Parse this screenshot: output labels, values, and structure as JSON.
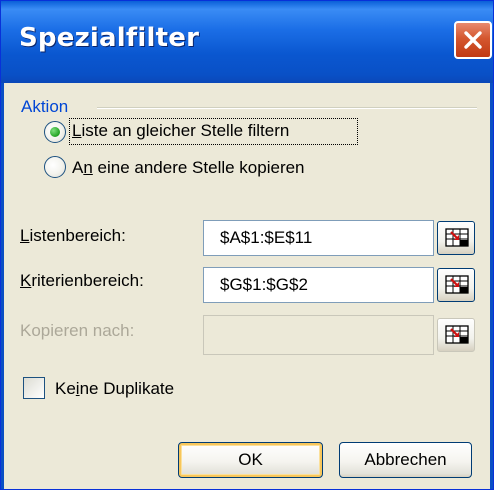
{
  "window": {
    "title": "Spezialfilter",
    "close_icon": "close-icon"
  },
  "group": {
    "label": "Aktion"
  },
  "radios": [
    {
      "pre": "",
      "u": "L",
      "post": "iste an gleicher Stelle filtern",
      "selected": true
    },
    {
      "pre": "A",
      "u": "n",
      "post": " eine andere Stelle kopieren",
      "selected": false
    }
  ],
  "fields": [
    {
      "label_pre": "",
      "label_u": "L",
      "label_post": "istenbereich:",
      "value": "$A$1:$E$11",
      "enabled": true
    },
    {
      "label_pre": "",
      "label_u": "K",
      "label_post": "riterienbereich:",
      "value": "$G$1:$G$2",
      "enabled": true
    },
    {
      "label_pre": "Kopieren nach:",
      "label_u": "",
      "label_post": "",
      "value": "",
      "enabled": false
    }
  ],
  "checkbox": {
    "pre": "Ke",
    "u": "i",
    "post": "ne Duplikate",
    "checked": false
  },
  "buttons": {
    "ok": "OK",
    "cancel": "Abbrechen"
  },
  "colors": {
    "title_bar": "#0a57d0",
    "group_label": "#0046d5",
    "close_button": "#c13a14",
    "dialog_bg": "#ece9d8"
  }
}
